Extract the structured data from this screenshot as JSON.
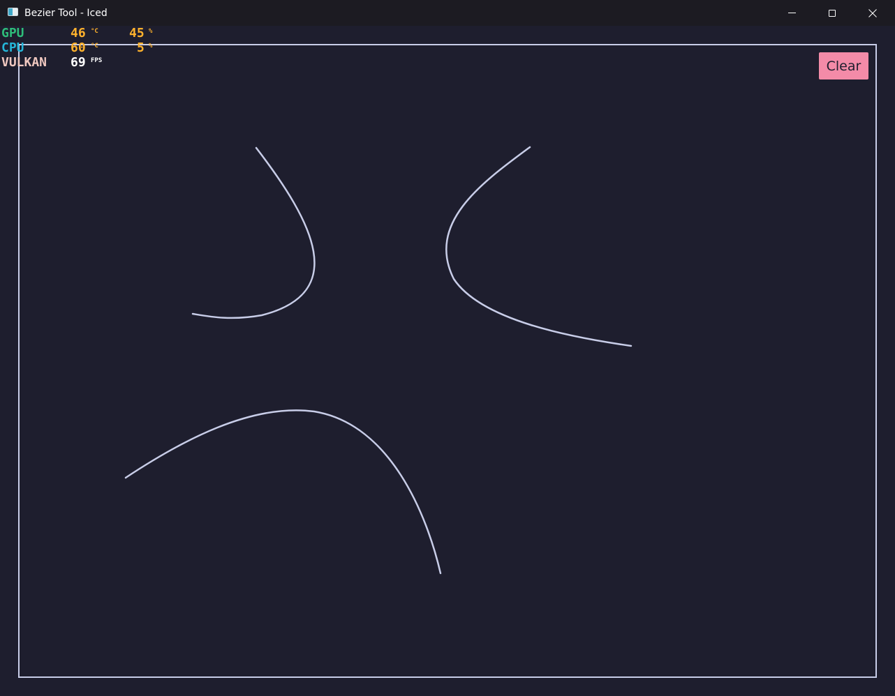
{
  "window": {
    "title": "Bezier Tool - Iced",
    "icon": "app-window-icon",
    "controls": {
      "minimize_icon": "minimize-icon",
      "maximize_icon": "maximize-icon",
      "close_icon": "close-icon"
    }
  },
  "overlay": {
    "rows": [
      {
        "label": "GPU",
        "label_color": "#2ebd7a",
        "temp": "46",
        "temp_unit": "°C",
        "load": "45",
        "load_unit": "%"
      },
      {
        "label": "CPU",
        "label_color": "#25b6d9",
        "temp": "60",
        "temp_unit": "°C",
        "load": "5",
        "load_unit": "%"
      },
      {
        "label": "VULKAN",
        "label_color": "#f0c8c0",
        "fps": "69",
        "fps_unit": "FPS"
      }
    ],
    "value_color": "#ffb22d"
  },
  "canvas": {
    "border_color": "#c8cde8",
    "curve_color": "#c8cde8",
    "background": "#1e1e2e"
  },
  "toolbar": {
    "clear_label": "Clear",
    "clear_color": "#f38ba8"
  }
}
